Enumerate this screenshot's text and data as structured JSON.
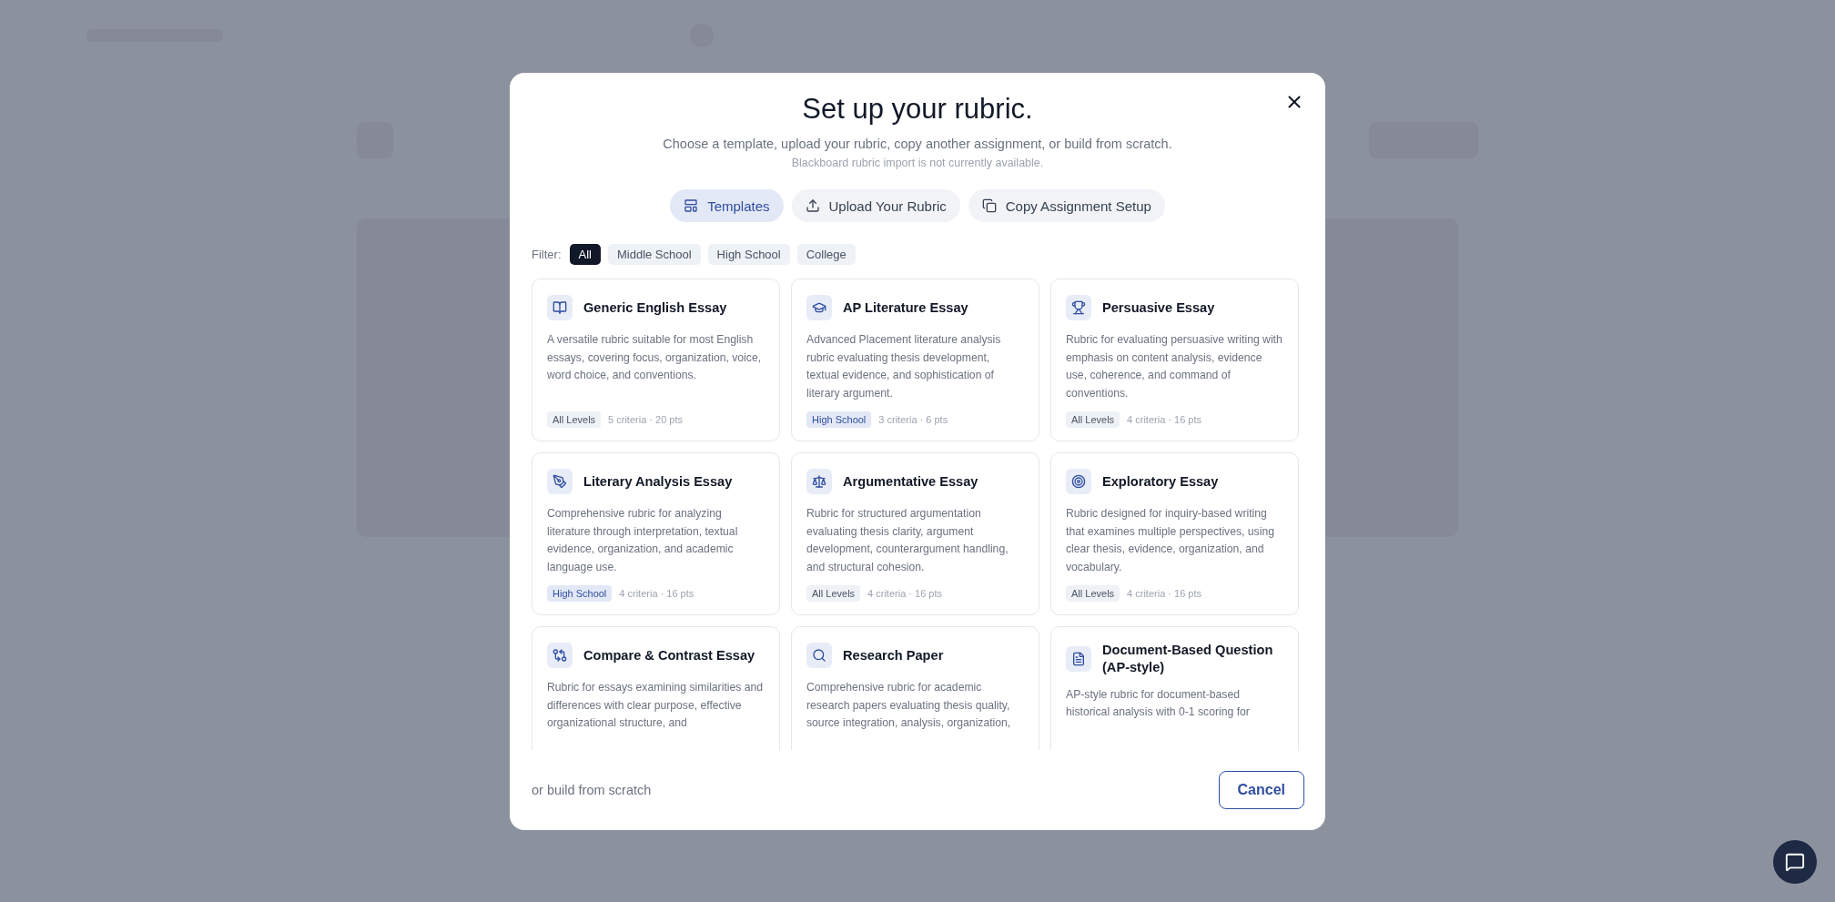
{
  "dialog": {
    "title": "Set up your rubric.",
    "subtitle": "Choose a template, upload your rubric, copy another assignment, or build from scratch.",
    "note": "Blackboard rubric import is not currently available.",
    "tabs": [
      {
        "label": "Templates",
        "selected": true
      },
      {
        "label": "Upload Your Rubric",
        "selected": false
      },
      {
        "label": "Copy Assignment Setup",
        "selected": false
      }
    ],
    "filter": {
      "label": "Filter:",
      "options": [
        {
          "label": "All",
          "selected": true
        },
        {
          "label": "Middle School",
          "selected": false
        },
        {
          "label": "High School",
          "selected": false
        },
        {
          "label": "College",
          "selected": false
        }
      ]
    },
    "templates": [
      {
        "title": "Generic English Essay",
        "description": "A versatile rubric suitable for most English essays, covering focus, organization, voice, word choice, and conventions.",
        "level": {
          "label": "All Levels",
          "kind": "all"
        },
        "meta": "5 criteria · 20 pts"
      },
      {
        "title": "AP Literature Essay",
        "description": "Advanced Placement literature analysis rubric evaluating thesis development, textual evidence, and sophistication of literary argument.",
        "level": {
          "label": "High School",
          "kind": "specific"
        },
        "meta": "3 criteria · 6 pts"
      },
      {
        "title": "Persuasive Essay",
        "description": "Rubric for evaluating persuasive writing with emphasis on content analysis, evidence use, coherence, and command of conventions.",
        "level": {
          "label": "All Levels",
          "kind": "all"
        },
        "meta": "4 criteria · 16 pts"
      },
      {
        "title": "Literary Analysis Essay",
        "description": "Comprehensive rubric for analyzing literature through interpretation, textual evidence, organization, and academic language use.",
        "level": {
          "label": "High School",
          "kind": "specific"
        },
        "meta": "4 criteria · 16 pts"
      },
      {
        "title": "Argumentative Essay",
        "description": "Rubric for structured argumentation evaluating thesis clarity, argument development, counterargument handling, and structural cohesion.",
        "level": {
          "label": "All Levels",
          "kind": "all"
        },
        "meta": "4 criteria · 16 pts"
      },
      {
        "title": "Exploratory Essay",
        "description": "Rubric designed for inquiry-based writing that examines multiple perspectives, using clear thesis, evidence, organization, and vocabulary.",
        "level": {
          "label": "All Levels",
          "kind": "all"
        },
        "meta": "4 criteria · 16 pts"
      },
      {
        "title": "Compare & Contrast Essay",
        "description": "Rubric for essays examining similarities and differences with clear purpose, effective organizational structure, and"
      },
      {
        "title": "Research Paper",
        "description": "Comprehensive rubric for academic research papers evaluating thesis quality, source integration, analysis, organization,"
      },
      {
        "title": "Document-Based Question (AP-style)",
        "description": "AP-style rubric for document-based historical analysis with 0-1 scoring for"
      }
    ],
    "footer_text": "or build from scratch",
    "cancel": "Cancel"
  }
}
